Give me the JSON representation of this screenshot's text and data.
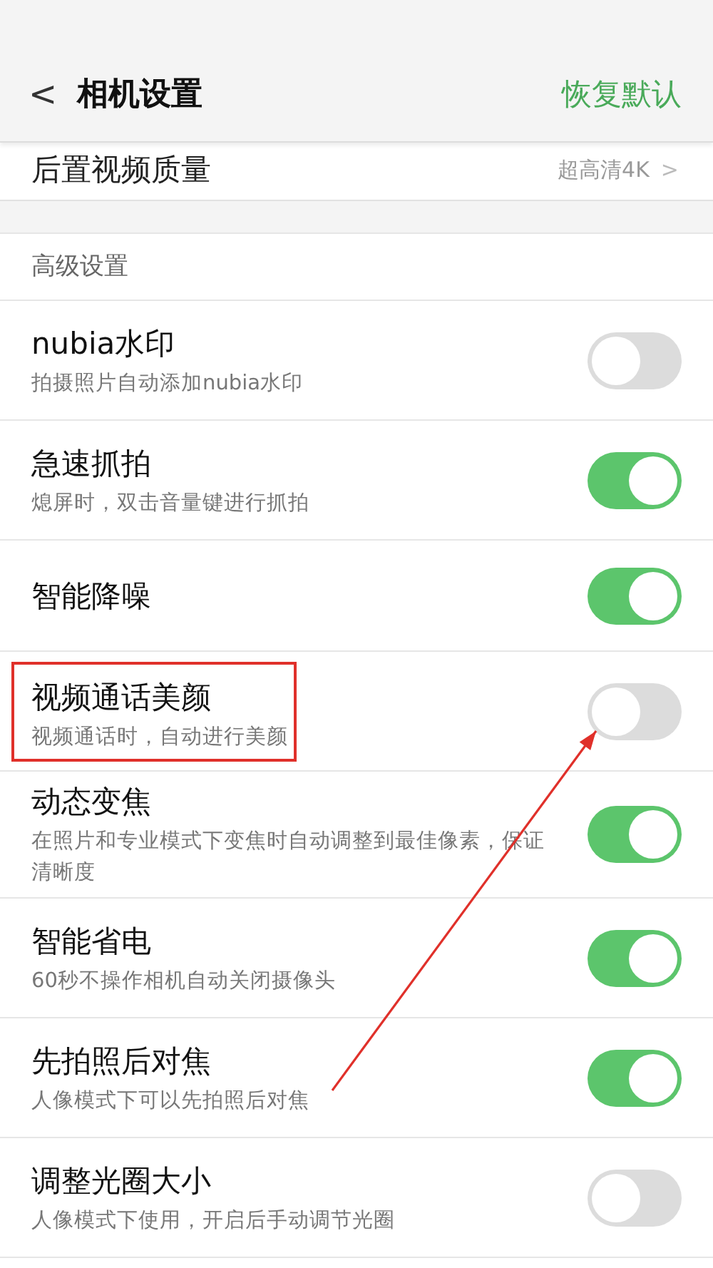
{
  "header": {
    "back": "<",
    "title": "相机设置",
    "action": "恢复默认"
  },
  "partial_row": {
    "label": "后置视频质量",
    "value": "超高清4K",
    "chevron": ">"
  },
  "section": {
    "title": "高级设置"
  },
  "settings": [
    {
      "title": "nubia水印",
      "subtitle": "拍摄照片自动添加nubia水印",
      "on": false,
      "highlighted": false
    },
    {
      "title": "急速抓拍",
      "subtitle": "熄屏时，双击音量键进行抓拍",
      "on": true,
      "highlighted": false
    },
    {
      "title": "智能降噪",
      "on": true,
      "highlighted": false
    },
    {
      "title": "视频通话美颜",
      "subtitle": "视频通话时，自动进行美颜",
      "on": false,
      "highlighted": true
    },
    {
      "title": "动态变焦",
      "subtitle": "在照片和专业模式下变焦时自动调整到最佳像素，保证清晰度",
      "on": true,
      "highlighted": false
    },
    {
      "title": "智能省电",
      "subtitle": "60秒不操作相机自动关闭摄像头",
      "on": true,
      "highlighted": false
    },
    {
      "title": "先拍照后对焦",
      "subtitle": "人像模式下可以先拍照后对焦",
      "on": true,
      "highlighted": false
    },
    {
      "title": "调整光圈大小",
      "subtitle": "人像模式下使用，开启后手动调节光圈",
      "on": false,
      "highlighted": false
    }
  ]
}
